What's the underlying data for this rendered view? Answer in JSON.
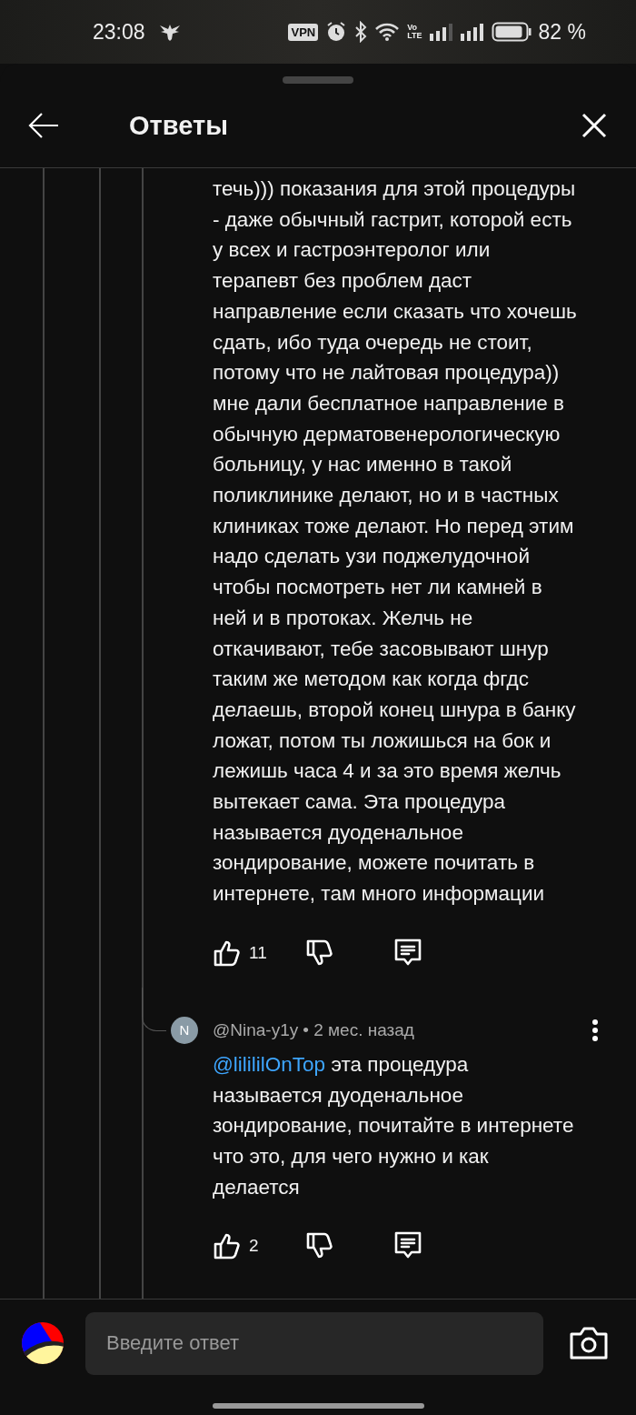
{
  "status_bar": {
    "time": "23:08",
    "vpn": "VPN",
    "volte": [
      "Vo",
      "LTE"
    ],
    "battery": "82 %"
  },
  "header": {
    "title": "Ответы"
  },
  "comments": [
    {
      "kind": "continued",
      "text": "течь))) показания для этой процедуры - даже обычный гастрит, которой есть у всех и гастроэнтеролог или терапевт без проблем даст направление если сказать что хочешь сдать, ибо туда очередь не стоит, потому что не лайтовая процедура)) мне дали бесплатное направление в обычную дерматовенерологическую больницу, у нас именно в такой поликлинике делают, но и в частных клиниках тоже делают. Но перед этим надо сделать узи поджелудочной чтобы посмотреть нет ли камней в ней и в протоках. Желчь не откачивают, тебе засовывают шнур таким же методом как когда фгдс делаешь, второй конец шнура в банку ложат, потом ты ложишься на бок и лежишь часа 4 и за это время желчь вытекает сама. Эта процедура называется дуоденальное зондирование, можете почитать в интернете, там много информации",
      "likes": "11"
    },
    {
      "kind": "reply",
      "avatar_letter": "N",
      "author": "@Nina-y1y",
      "meta": "• 2 мес. назад",
      "mention": "@lilililOnTop",
      "text": "эта процедура называется дуоденальное зондирование, почитайте в интернете что это, для чего нужно и как делается",
      "likes": "2"
    }
  ],
  "composer": {
    "placeholder": "Введите ответ"
  }
}
